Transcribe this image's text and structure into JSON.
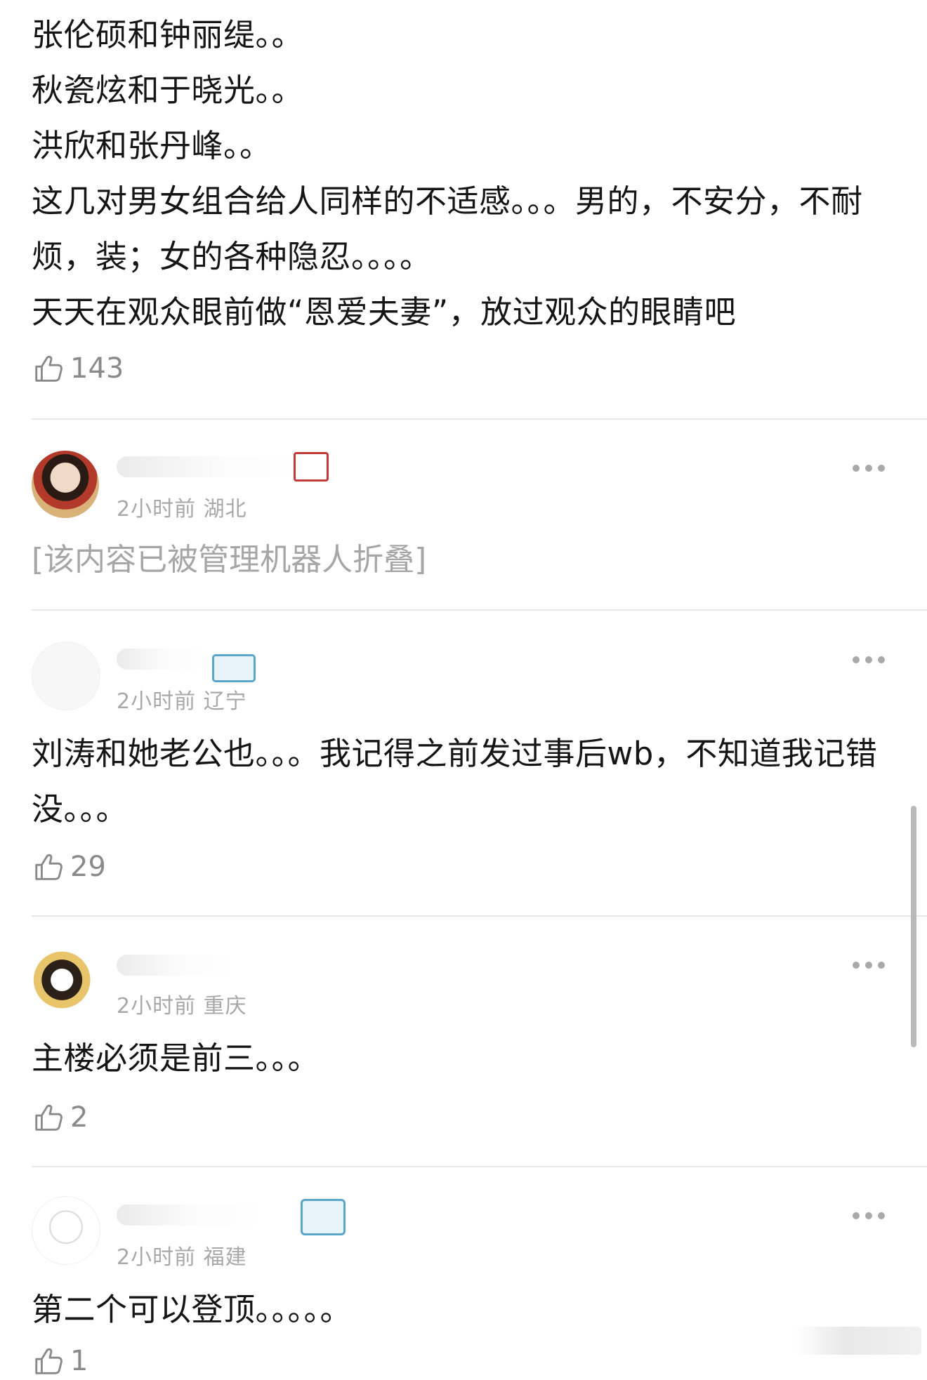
{
  "comments": [
    {
      "text": "张伦硕和钟丽缇。。\n秋瓷炫和于晓光。。\n洪欣和张丹峰。。\n这几对男女组合给人同样的不适感。。。男的，不安分，不耐烦，装；女的各种隐忍。。。。\n天天在观众眼前做“恩爱夫妻”，放过观众的眼睛吧",
      "likes": "143"
    },
    {
      "meta": "2小时前 湖北",
      "folded_text": "[该内容已被管理机器人折叠]",
      "more_icon": "more-dots-icon"
    },
    {
      "meta": "2小时前 辽宁",
      "text": "刘涛和她老公也。。。我记得之前发过事后wb，不知道我记错没。。。",
      "likes": "29",
      "more_icon": "more-dots-icon"
    },
    {
      "meta": "2小时前 重庆",
      "text": "主楼必须是前三。。。",
      "likes": "2",
      "more_icon": "more-dots-icon"
    },
    {
      "meta": "2小时前 福建",
      "text": "第二个可以登顶。。。。。",
      "likes": "1",
      "more_icon": "more-dots-icon"
    }
  ],
  "colors": {
    "text": "#151515",
    "meta": "#a8a8a8",
    "folded": "#a6a6a6",
    "like": "#8a8a8a",
    "divider": "#e7e7e7"
  },
  "icons": {
    "like": "thumbs-up-icon",
    "more": "more-dots-icon",
    "badge": "id-card-badge-icon"
  }
}
